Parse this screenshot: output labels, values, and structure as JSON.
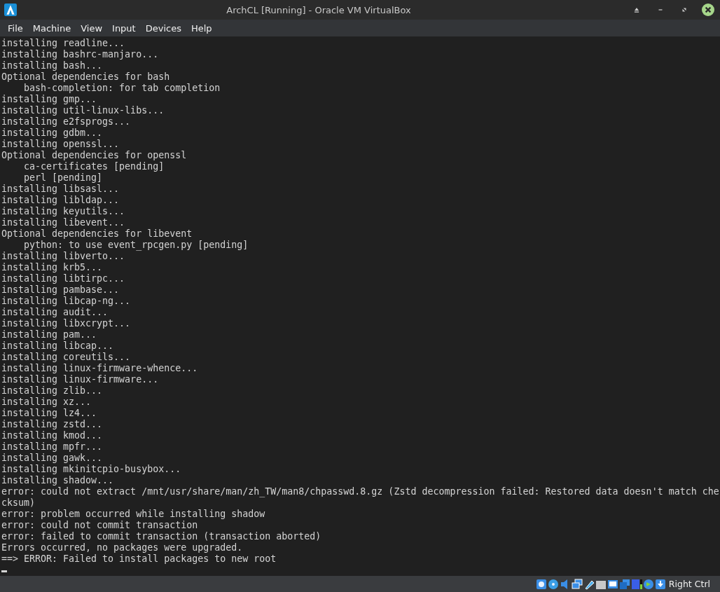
{
  "window": {
    "title": "ArchCL [Running] - Oracle VM VirtualBox"
  },
  "menu": [
    "File",
    "Machine",
    "View",
    "Input",
    "Devices",
    "Help"
  ],
  "terminal": {
    "lines": [
      "installing readline...",
      "installing bashrc-manjaro...",
      "installing bash...",
      "Optional dependencies for bash",
      "    bash-completion: for tab completion",
      "installing gmp...",
      "installing util-linux-libs...",
      "installing e2fsprogs...",
      "installing gdbm...",
      "installing openssl...",
      "Optional dependencies for openssl",
      "    ca-certificates [pending]",
      "    perl [pending]",
      "installing libsasl...",
      "installing libldap...",
      "installing keyutils...",
      "installing libevent...",
      "Optional dependencies for libevent",
      "    python: to use event_rpcgen.py [pending]",
      "installing libverto...",
      "installing krb5...",
      "installing libtirpc...",
      "installing pambase...",
      "installing libcap-ng...",
      "installing audit...",
      "installing libxcrypt...",
      "installing pam...",
      "installing libcap...",
      "installing coreutils...",
      "installing linux-firmware-whence...",
      "installing linux-firmware...",
      "installing zlib...",
      "installing xz...",
      "installing lz4...",
      "installing zstd...",
      "installing kmod...",
      "installing mpfr...",
      "installing gawk...",
      "installing mkinitcpio-busybox...",
      "installing shadow...",
      "error: could not extract /mnt/usr/share/man/zh_TW/man8/chpasswd.8.gz (Zstd decompression failed: Restored data doesn't match che",
      "cksum)",
      "error: problem occurred while installing shadow",
      "error: could not commit transaction",
      "error: failed to commit transaction (transaction aborted)",
      "Errors occurred, no packages were upgraded.",
      "==> ERROR: Failed to install packages to new root"
    ]
  },
  "status_bar": {
    "host_key": "Right Ctrl"
  }
}
